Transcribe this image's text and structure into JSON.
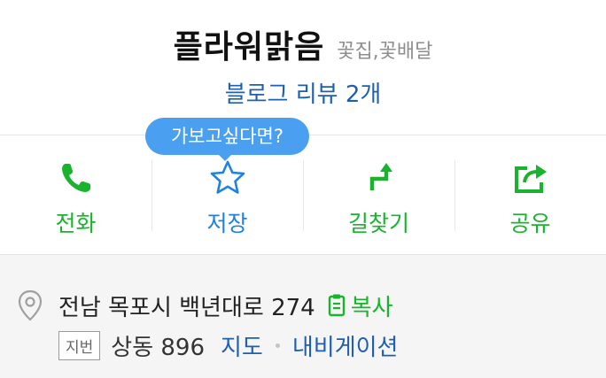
{
  "header": {
    "place_name": "플라워맑음",
    "category": "꽃집,꽃배달",
    "review_link": "블로그 리뷰 2개"
  },
  "tooltip": {
    "text": "가보고싶다면?"
  },
  "actions": {
    "call": {
      "label": "전화",
      "icon": "phone-icon"
    },
    "save": {
      "label": "저장",
      "icon": "star-icon"
    },
    "directions": {
      "label": "길찾기",
      "icon": "route-arrow-icon"
    },
    "share": {
      "label": "공유",
      "icon": "share-icon"
    }
  },
  "address": {
    "road": "전남 목포시 백년대로 274",
    "copy_label": "복사",
    "jibun_badge": "지번",
    "jibun": "상동 896",
    "map_label": "지도",
    "navigation_label": "내비게이션"
  },
  "colors": {
    "green": "#19b32d",
    "blue": "#1f82e3",
    "link_blue": "#1f5fae",
    "tooltip_bg": "#4a9ff0"
  }
}
